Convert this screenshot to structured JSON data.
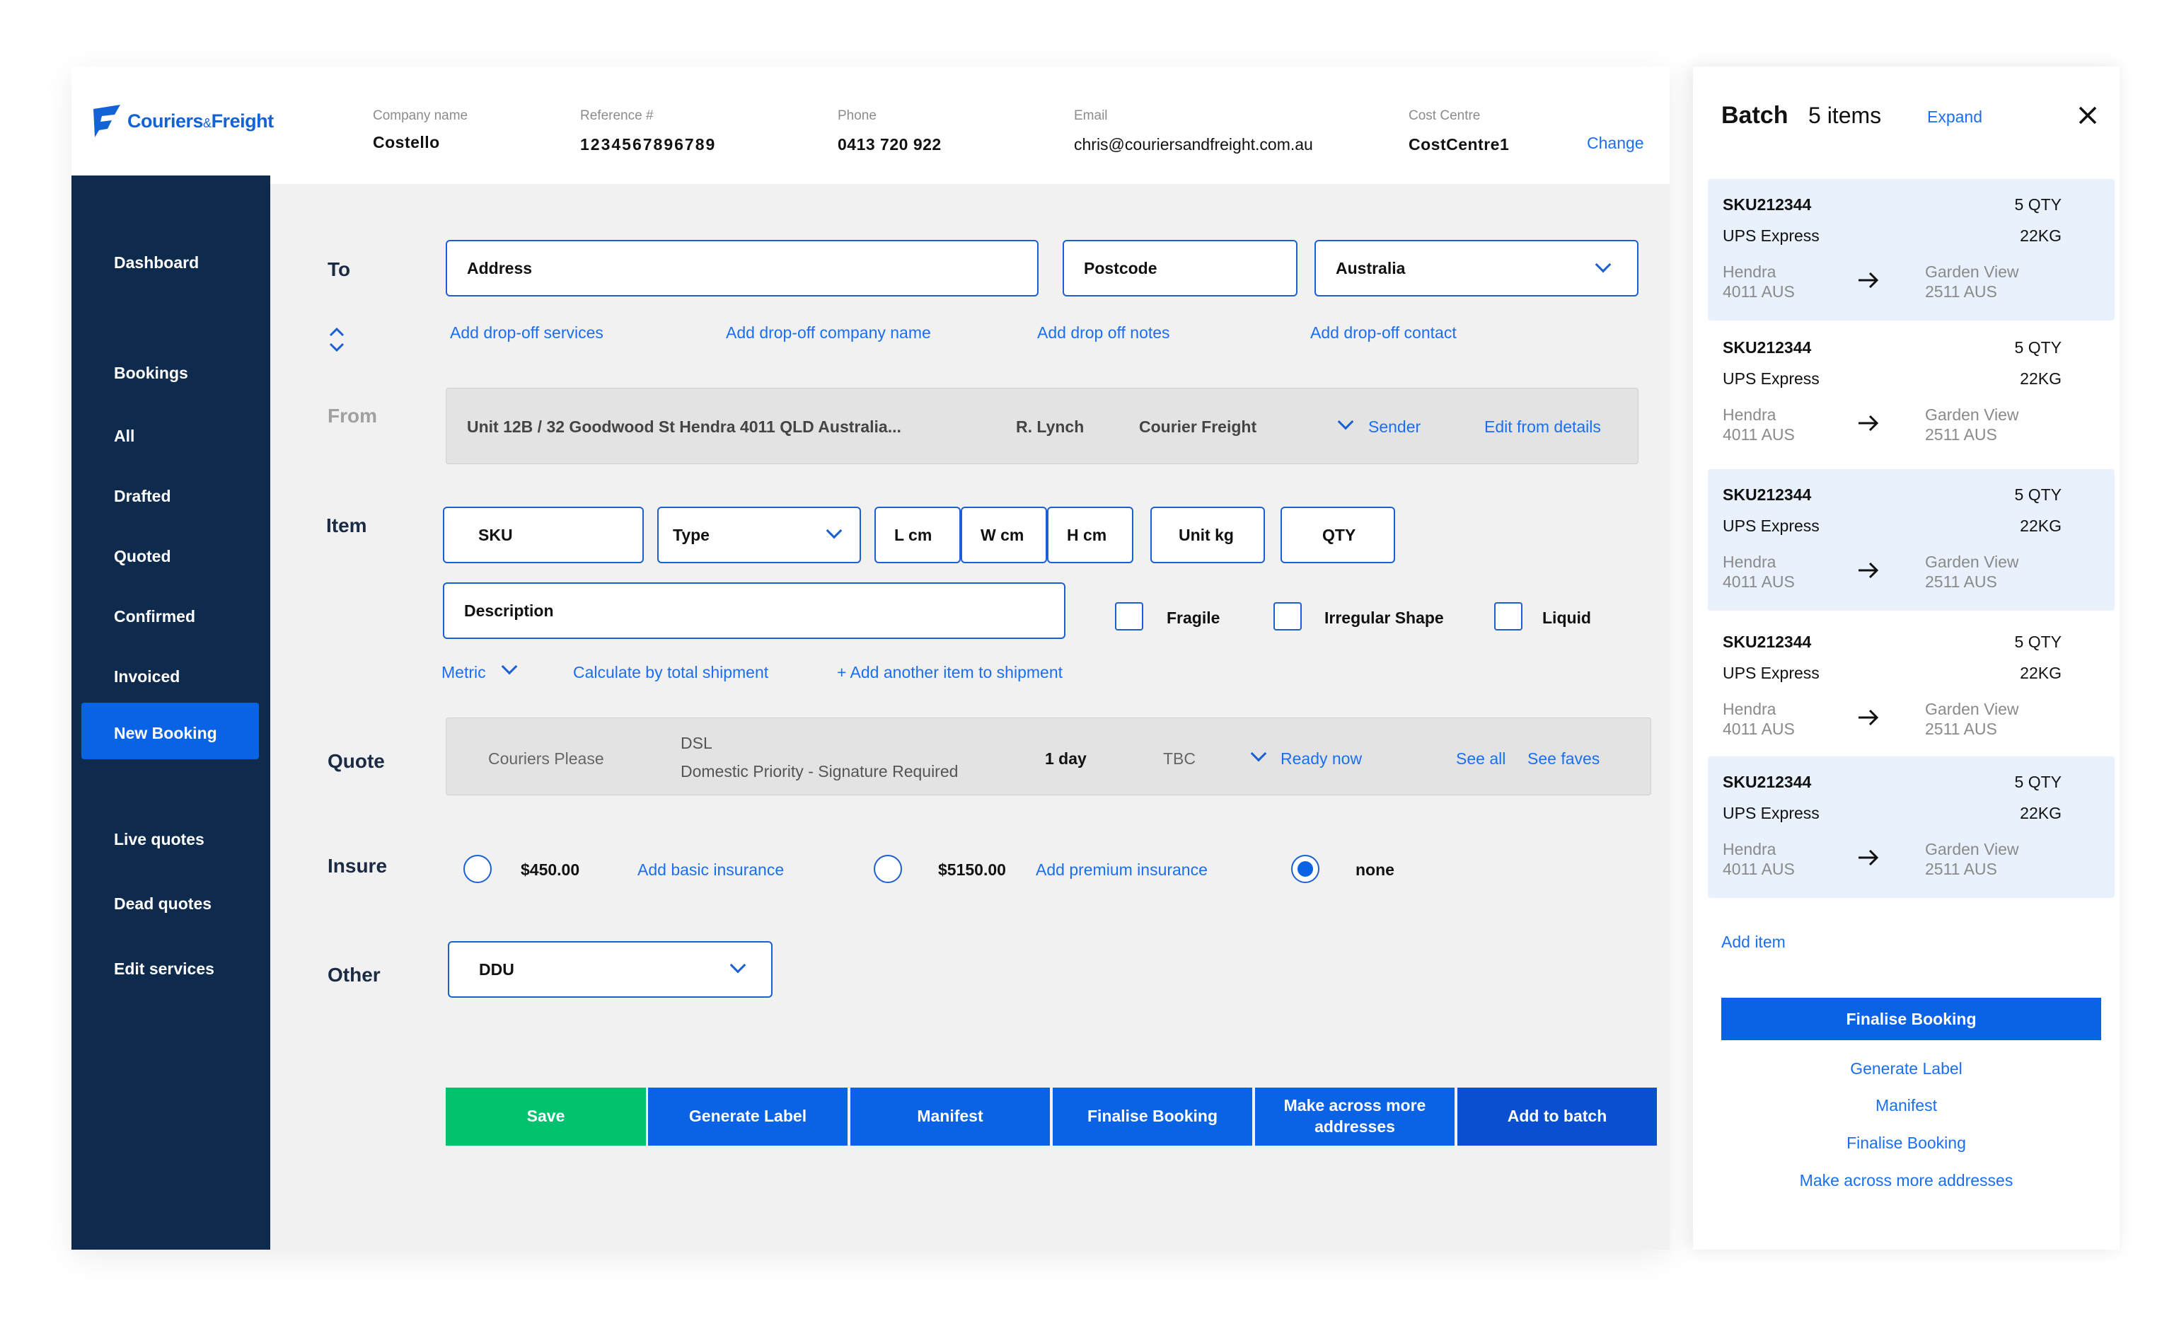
{
  "header": {
    "brand": "Couriers",
    "brand_amp": "&",
    "brand_suffix": "Freight",
    "fields": [
      {
        "label": "Company name",
        "value": "Costello"
      },
      {
        "label": "Reference #",
        "value": "1234567896789"
      },
      {
        "label": "Phone",
        "value": "0413 720 922"
      },
      {
        "label": "Email",
        "value": "chris@couriersandfreight.com.au"
      },
      {
        "label": "Cost Centre",
        "value": "CostCentre1"
      }
    ],
    "change_link": "Change"
  },
  "sidebar": {
    "items": [
      {
        "label": "Dashboard"
      },
      {
        "label": "Bookings"
      },
      {
        "label": "All"
      },
      {
        "label": "Drafted"
      },
      {
        "label": "Quoted"
      },
      {
        "label": "Confirmed"
      },
      {
        "label": "Invoiced"
      },
      {
        "label": "New Booking",
        "active": true
      },
      {
        "label": "Live quotes"
      },
      {
        "label": "Dead quotes"
      },
      {
        "label": "Edit services"
      }
    ]
  },
  "form": {
    "to_label": "To",
    "address_placeholder": "Address",
    "postcode_placeholder": "Postcode",
    "country_value": "Australia",
    "to_links": [
      "Add drop-off services",
      "Add drop-off company name",
      "Add drop off notes",
      "Add drop-off contact"
    ],
    "from_label": "From",
    "from_address": "Unit 12B / 32 Goodwood St Hendra 4011 QLD Australia...",
    "from_contact": "R. Lynch",
    "from_company": "Courier Freight",
    "from_role": "Sender",
    "from_edit": "Edit from details",
    "item_label": "Item",
    "sku_placeholder": "SKU",
    "type_placeholder": "Type",
    "l_placeholder": "L cm",
    "w_placeholder": "W cm",
    "h_placeholder": "H cm",
    "unit_placeholder": "Unit kg",
    "qty_placeholder": "QTY",
    "description_placeholder": "Description",
    "checkboxes": [
      "Fragile",
      "Irregular Shape",
      "Liquid"
    ],
    "metric": "Metric",
    "calc_link": "Calculate by total shipment",
    "add_item_link": "+ Add another item to shipment",
    "quote_label": "Quote",
    "quote": {
      "carrier": "Couriers Please",
      "service_code": "DSL",
      "service_name": "Domestic Priority - Signature Required",
      "eta": "1 day",
      "price": "TBC",
      "ready": "Ready now",
      "see_all": "See all",
      "see_faves": "See faves"
    },
    "insure_label": "Insure",
    "insure_options": [
      {
        "amount": "$450.00",
        "link": "Add basic insurance"
      },
      {
        "amount": "$5150.00",
        "link": "Add premium insurance"
      },
      {
        "amount": "none",
        "selected": true
      }
    ],
    "other_label": "Other",
    "other_value": "DDU"
  },
  "actions": {
    "save": "Save",
    "generate_label": "Generate Label",
    "manifest": "Manifest",
    "finalise": "Finalise Booking",
    "multi_address": "Make across more addresses",
    "add_to_batch": "Add to batch"
  },
  "colors": {
    "sidebar": "#0e2a4d",
    "accent": "#0a62e5",
    "save": "#00c16e",
    "batch_highlight": "#e8f1fc"
  },
  "batch": {
    "title": "Batch",
    "count": "5 items",
    "expand": "Expand",
    "items": [
      {
        "sku": "SKU212344",
        "qty": "5 QTY",
        "service": "UPS Express",
        "weight": "22KG",
        "from_city": "Hendra",
        "from_code": "4011 AUS",
        "to_city": "Garden View",
        "to_code": "2511 AUS"
      },
      {
        "sku": "SKU212344",
        "qty": "5 QTY",
        "service": "UPS Express",
        "weight": "22KG",
        "from_city": "Hendra",
        "from_code": "4011 AUS",
        "to_city": "Garden View",
        "to_code": "2511 AUS"
      },
      {
        "sku": "SKU212344",
        "qty": "5 QTY",
        "service": "UPS Express",
        "weight": "22KG",
        "from_city": "Hendra",
        "from_code": "4011 AUS",
        "to_city": "Garden View",
        "to_code": "2511 AUS"
      },
      {
        "sku": "SKU212344",
        "qty": "5 QTY",
        "service": "UPS Express",
        "weight": "22KG",
        "from_city": "Hendra",
        "from_code": "4011 AUS",
        "to_city": "Garden View",
        "to_code": "2511 AUS"
      },
      {
        "sku": "SKU212344",
        "qty": "5 QTY",
        "service": "UPS Express",
        "weight": "22KG",
        "from_city": "Hendra",
        "from_code": "4011 AUS",
        "to_city": "Garden View",
        "to_code": "2511 AUS"
      }
    ],
    "add_item": "Add item",
    "finalise_button": "Finalise Booking",
    "links": [
      "Generate Label",
      "Manifest",
      "Finalise Booking",
      "Make across more addresses"
    ]
  }
}
